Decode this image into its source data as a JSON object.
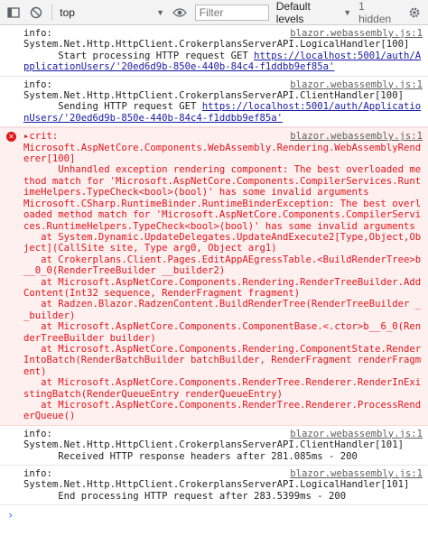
{
  "toolbar": {
    "context": "top",
    "filter_placeholder": "Filter",
    "levels": "Default levels",
    "hidden_count": "1 hidden"
  },
  "logs": {
    "info1": {
      "label": "info:",
      "lines": [
        "System.Net.Http.HttpClient.CrokerplansServerAPI.LogicalHandler[100]",
        "      Start processing HTTP request GET "
      ],
      "url": "https://localhost:5001/auth/ApplicationUsers/'20ed6d9b-850e-440b-84c4-f1ddbb9ef85a'",
      "source": "blazor.webassembly.js:1"
    },
    "info2": {
      "label": "info:",
      "lines": [
        "System.Net.Http.HttpClient.CrokerplansServerAPI.ClientHandler[100]",
        "      Sending HTTP request GET "
      ],
      "url": "https://localhost:5001/auth/ApplicationUsers/'20ed6d9b-850e-440b-84c4-f1ddbb9ef85a'",
      "source": "blazor.webassembly.js:1"
    },
    "crit": {
      "label": "crit:",
      "source": "blazor.webassembly.js:1",
      "text": "Microsoft.AspNetCore.Components.WebAssembly.Rendering.WebAssemblyRenderer[100]\n      Unhandled exception rendering component: The best overloaded method match for 'Microsoft.AspNetCore.Components.CompilerServices.RuntimeHelpers.TypeCheck<bool>(bool)' has some invalid arguments\nMicrosoft.CSharp.RuntimeBinder.RuntimeBinderException: The best overloaded method match for 'Microsoft.AspNetCore.Components.CompilerServices.RuntimeHelpers.TypeCheck<bool>(bool)' has some invalid arguments\n   at System.Dynamic.UpdateDelegates.UpdateAndExecute2[Type,Object,Object](CallSite site, Type arg0, Object arg1)\n   at Crokerplans.Client.Pages.EditAppAEgressTable.<BuildRenderTree>b__0_0(RenderTreeBuilder __builder2)\n   at Microsoft.AspNetCore.Components.Rendering.RenderTreeBuilder.AddContent(Int32 sequence, RenderFragment fragment)\n   at Radzen.Blazor.RadzenContent.BuildRenderTree(RenderTreeBuilder __builder)\n   at Microsoft.AspNetCore.Components.ComponentBase.<.ctor>b__6_0(RenderTreeBuilder builder)\n   at Microsoft.AspNetCore.Components.Rendering.ComponentState.RenderIntoBatch(RenderBatchBuilder batchBuilder, RenderFragment renderFragment)\n   at Microsoft.AspNetCore.Components.RenderTree.Renderer.RenderInExistingBatch(RenderQueueEntry renderQueueEntry)\n   at Microsoft.AspNetCore.Components.RenderTree.Renderer.ProcessRenderQueue()"
    },
    "info3": {
      "label": "info:",
      "text": "System.Net.Http.HttpClient.CrokerplansServerAPI.ClientHandler[101]\n      Received HTTP response headers after 281.085ms - 200",
      "source": "blazor.webassembly.js:1"
    },
    "info4": {
      "label": "info:",
      "text": "System.Net.Http.HttpClient.CrokerplansServerAPI.LogicalHandler[101]\n      End processing HTTP request after 283.5399ms - 200",
      "source": "blazor.webassembly.js:1"
    }
  },
  "prompt_symbol": "›"
}
